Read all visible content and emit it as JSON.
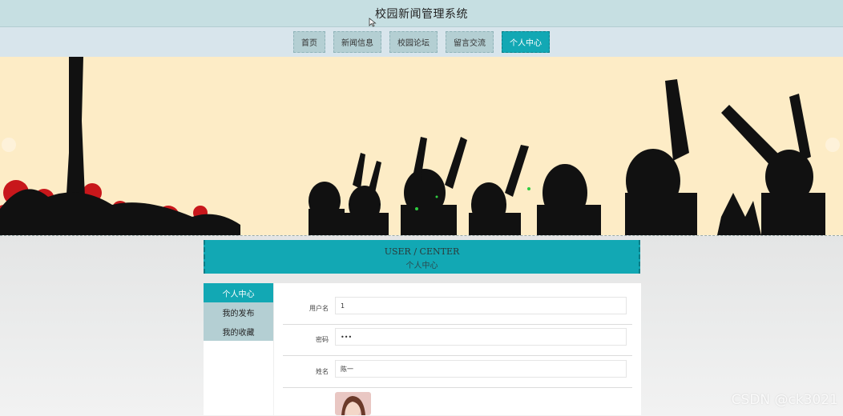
{
  "header": {
    "site_title": "校园新闻管理系统"
  },
  "nav": {
    "items": [
      {
        "label": "首页"
      },
      {
        "label": "新闻信息"
      },
      {
        "label": "校园论坛"
      },
      {
        "label": "留言交流"
      },
      {
        "label": "个人中心",
        "active": true
      }
    ]
  },
  "section": {
    "title_en": "USER / CENTER",
    "title_cn": "个人中心"
  },
  "side_menu": {
    "items": [
      {
        "label": "个人中心",
        "active": true
      },
      {
        "label": "我的发布"
      },
      {
        "label": "我的收藏"
      }
    ]
  },
  "form": {
    "username_label": "用户名",
    "username_value": "1",
    "password_label": "密码",
    "password_value": "•••",
    "name_label": "姓名",
    "name_value": "陈一"
  },
  "watermark": "CSDN @ck3021",
  "colors": {
    "accent": "#12a8b4",
    "nav_bg": "#b4cfd3",
    "banner_bg": "#fdecc6"
  }
}
